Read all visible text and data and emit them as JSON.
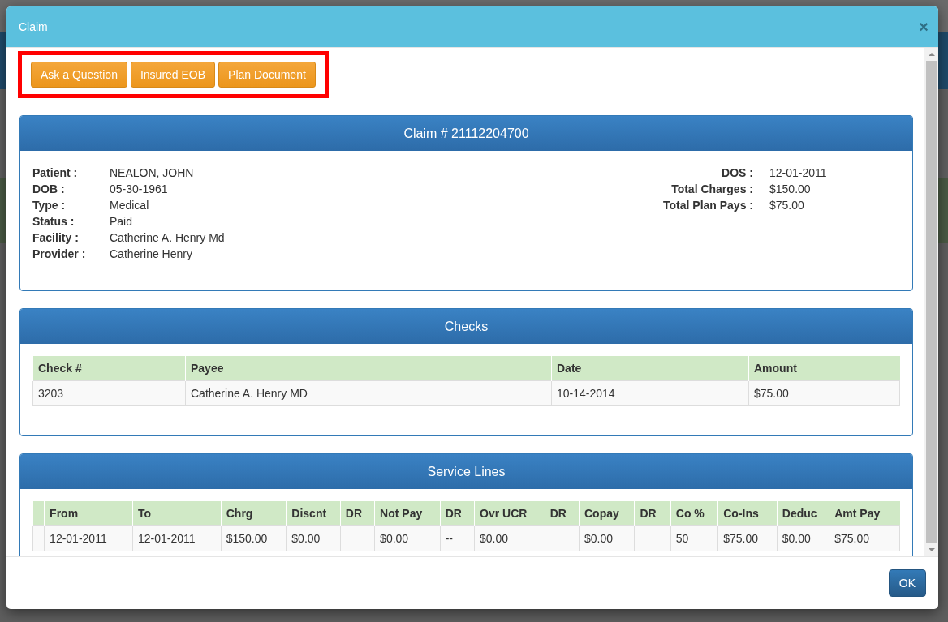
{
  "modal": {
    "title": "Claim",
    "close": "×"
  },
  "actions": [
    {
      "label": "Ask a Question"
    },
    {
      "label": "Insured EOB"
    },
    {
      "label": "Plan Document"
    }
  ],
  "claim": {
    "heading": "Claim # 21112204700",
    "left": [
      {
        "label": "Patient :",
        "value": "NEALON, JOHN"
      },
      {
        "label": "DOB :",
        "value": "05-30-1961"
      },
      {
        "label": "Type :",
        "value": "Medical"
      },
      {
        "label": "Status :",
        "value": "Paid"
      },
      {
        "label": "Facility :",
        "value": "Catherine A. Henry Md"
      },
      {
        "label": "Provider :",
        "value": "Catherine Henry"
      }
    ],
    "right": [
      {
        "label": "DOS :",
        "value": "12-01-2011"
      },
      {
        "label": "Total Charges :",
        "value": "$150.00"
      },
      {
        "label": "Total Plan Pays :",
        "value": "$75.00"
      }
    ]
  },
  "checks": {
    "heading": "Checks",
    "columns": [
      "Check #",
      "Payee",
      "Date",
      "Amount"
    ],
    "rows": [
      [
        "3203",
        "Catherine A. Henry MD",
        "10-14-2014",
        "$75.00"
      ]
    ]
  },
  "service_lines": {
    "heading": "Service Lines",
    "columns": [
      null,
      "From",
      "To",
      "Chrg",
      "Discnt",
      "DR",
      "Not Pay",
      "DR",
      "Ovr UCR",
      "DR",
      "Copay",
      "DR",
      "Co %",
      "Co-Ins",
      "Deduc",
      "Amt Pay"
    ],
    "rows": [
      [
        null,
        "12-01-2011",
        "12-01-2011",
        "$150.00",
        "$0.00",
        null,
        "$0.00",
        "--",
        "$0.00",
        null,
        "$0.00",
        null,
        "50",
        "$75.00",
        "$0.00",
        "$75.00"
      ]
    ]
  },
  "footer": {
    "button": "OK"
  }
}
